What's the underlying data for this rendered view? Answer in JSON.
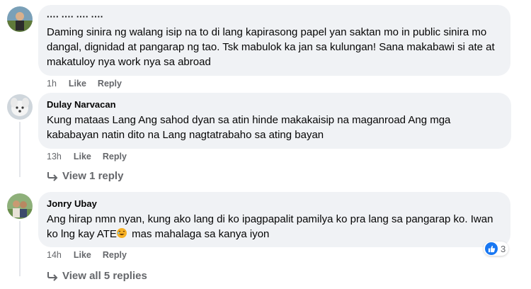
{
  "comments": [
    {
      "author": "···· ···· ···· ····",
      "text": "Daming sinira ng walang isip na to di lang kapirasong papel yan saktan mo in public sinira mo dangal, dignidad at pangarap ng tao. Tsk mabulok ka jan sa kulungan! Sana makabawi si ate at makatuloy nya work nya sa abroad",
      "time": "1h",
      "like_label": "Like",
      "reply_label": "Reply"
    },
    {
      "author": "Dulay Narvacan",
      "text": "Kung mataas Lang Ang sahod dyan sa atin hinde makakaisip na maganroad Ang mga kababayan natin dito na Lang nagtatrabaho sa ating bayan",
      "time": "13h",
      "like_label": "Like",
      "reply_label": "Reply",
      "view_replies": "View 1 reply"
    },
    {
      "author": "Jonry Ubay",
      "text_before_emoji": "Ang hirap nmn nyan, kung ako lang di ko ipagpapalit pamilya ko pra lang sa pangarap ko. Iwan ko lng kay ATE",
      "text_after_emoji": " mas mahalaga sa kanya iyon",
      "time": "14h",
      "like_label": "Like",
      "reply_label": "Reply",
      "reaction_count": "3",
      "view_replies": "View all 5 replies"
    }
  ],
  "icons": {
    "reaction": "like-thumb-icon",
    "emoji": "laughing-emoji-icon",
    "reply_arrow": "reply-arrow-icon"
  },
  "colors": {
    "bubble": "#f0f2f5",
    "meta_text": "#65676b",
    "like_blue": "#1877f2"
  }
}
